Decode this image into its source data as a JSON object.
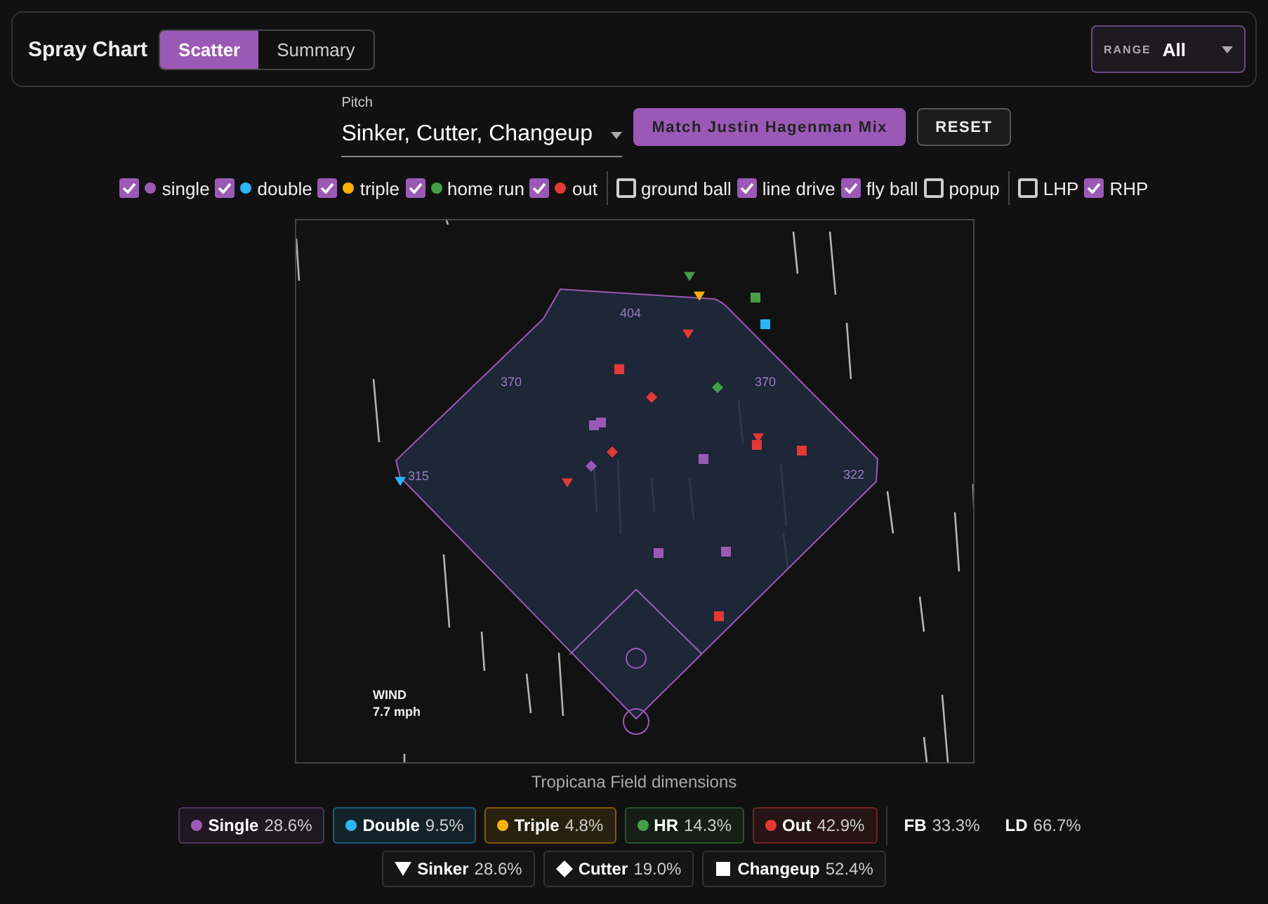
{
  "header": {
    "title": "Spray Chart",
    "tabs": [
      {
        "label": "Scatter",
        "selected": true
      },
      {
        "label": "Summary",
        "selected": false
      }
    ],
    "range": {
      "label": "RANGE",
      "value": "All"
    }
  },
  "pitch": {
    "label": "Pitch",
    "value": "Sinker, Cutter, Changeup"
  },
  "buttons": [
    {
      "label": "Match Justin Hagenman Mix",
      "kind": "primary"
    },
    {
      "label": "RESET",
      "kind": "secondary"
    }
  ],
  "filter_groups": [
    [
      {
        "label": "single",
        "checked": true,
        "color": "#9b59b6"
      },
      {
        "label": "double",
        "checked": true,
        "color": "#29b6f6"
      },
      {
        "label": "triple",
        "checked": true,
        "color": "#ffb300"
      },
      {
        "label": "home run",
        "checked": true,
        "color": "#43a047"
      },
      {
        "label": "out",
        "checked": true,
        "color": "#e53935"
      }
    ],
    [
      {
        "label": "ground ball",
        "checked": false
      },
      {
        "label": "line drive",
        "checked": true
      },
      {
        "label": "fly ball",
        "checked": true
      },
      {
        "label": "popup",
        "checked": false
      }
    ],
    [
      {
        "label": "LHP",
        "checked": false
      },
      {
        "label": "RHP",
        "checked": true
      }
    ]
  ],
  "field": {
    "distances": [
      "404",
      "370",
      "370",
      "315",
      "322"
    ],
    "wind_label": "WIND",
    "wind_speed": "7.7 mph",
    "caption": "Tropicana Field dimensions"
  },
  "outcome_legend": [
    {
      "label": "Single",
      "value": "28.6%",
      "color": "#9b59b6"
    },
    {
      "label": "Double",
      "value": "9.5%",
      "color": "#29b6f6"
    },
    {
      "label": "Triple",
      "value": "4.8%",
      "color": "#ffb300"
    },
    {
      "label": "HR",
      "value": "14.3%",
      "color": "#43a047"
    },
    {
      "label": "Out",
      "value": "42.9%",
      "color": "#e53935"
    }
  ],
  "type_stats": [
    {
      "label": "FB",
      "value": "33.3%"
    },
    {
      "label": "LD",
      "value": "66.7%"
    }
  ],
  "pitch_legend": [
    {
      "label": "Sinker",
      "value": "28.6%",
      "kind": "triangle"
    },
    {
      "label": "Cutter",
      "value": "19.0%",
      "kind": "diamond"
    },
    {
      "label": "Changeup",
      "value": "52.4%",
      "kind": "square"
    }
  ]
}
